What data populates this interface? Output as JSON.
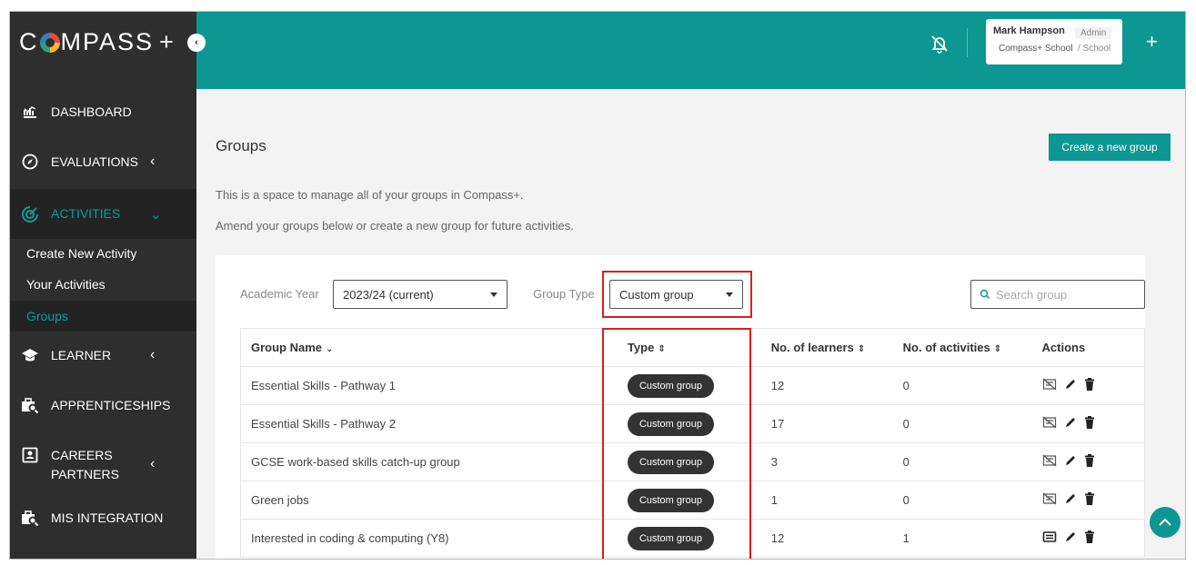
{
  "app": {
    "logo_text_left": "C",
    "logo_text_right": "MPASS",
    "logo_plus": "+"
  },
  "sidebar": {
    "collapse_glyph": "‹",
    "items": [
      {
        "label": "DASHBOARD",
        "icon": "dashboard-icon"
      },
      {
        "label": "EVALUATIONS",
        "icon": "compass-icon",
        "chevron": "‹"
      },
      {
        "label": "ACTIVITIES",
        "icon": "activities-icon",
        "chevron": "⌄",
        "active": true
      },
      {
        "label": "LEARNER",
        "icon": "mortarboard-icon",
        "chevron": "‹"
      },
      {
        "label": "APPRENTICESHIPS",
        "icon": "briefcase-search-icon"
      },
      {
        "label": "CAREERS",
        "label2": "PARTNERS",
        "icon": "id-card-icon",
        "chevron": "‹"
      },
      {
        "label": "MIS INTEGRATION",
        "icon": "briefcase-search-icon"
      }
    ],
    "sub_items": [
      {
        "label": "Create New Activity"
      },
      {
        "label": "Your Activities"
      },
      {
        "label": "Groups",
        "active": true
      }
    ]
  },
  "header": {
    "user_name": "Mark Hampson",
    "user_role": "Admin",
    "user_school": "Compass+ School",
    "user_school_type": "/ School",
    "plus_glyph": "+"
  },
  "page": {
    "title": "Groups",
    "create_button": "Create a new group",
    "intro_line1": "This is a space to manage all of your groups in Compass+.",
    "intro_line2": "Amend your groups below or create a new group for future activities."
  },
  "filters": {
    "academic_year_label": "Academic Year",
    "academic_year_value": "2023/24 (current)",
    "group_type_label": "Group Type",
    "group_type_value": "Custom group",
    "search_placeholder": "Search group"
  },
  "table": {
    "headers": {
      "group_name": "Group Name",
      "type": "Type",
      "learners": "No. of learners",
      "activities": "No. of activities",
      "actions": "Actions"
    },
    "rows": [
      {
        "name": "Essential Skills - Pathway 1",
        "type": "Custom group",
        "learners": "12",
        "activities": "0",
        "view_icon": "no-activities-icon"
      },
      {
        "name": "Essential Skills - Pathway 2",
        "type": "Custom group",
        "learners": "17",
        "activities": "0",
        "view_icon": "no-activities-icon"
      },
      {
        "name": "GCSE work-based skills catch-up group",
        "type": "Custom group",
        "learners": "3",
        "activities": "0",
        "view_icon": "no-activities-icon"
      },
      {
        "name": "Green jobs",
        "type": "Custom group",
        "learners": "1",
        "activities": "0",
        "view_icon": "no-activities-icon"
      },
      {
        "name": "Interested in coding & computing (Y8)",
        "type": "Custom group",
        "learners": "12",
        "activities": "1",
        "view_icon": "view-activities-icon"
      }
    ]
  },
  "colors": {
    "accent": "#0d9793",
    "sidebar": "#2e2e2e",
    "highlight": "#d62020"
  }
}
